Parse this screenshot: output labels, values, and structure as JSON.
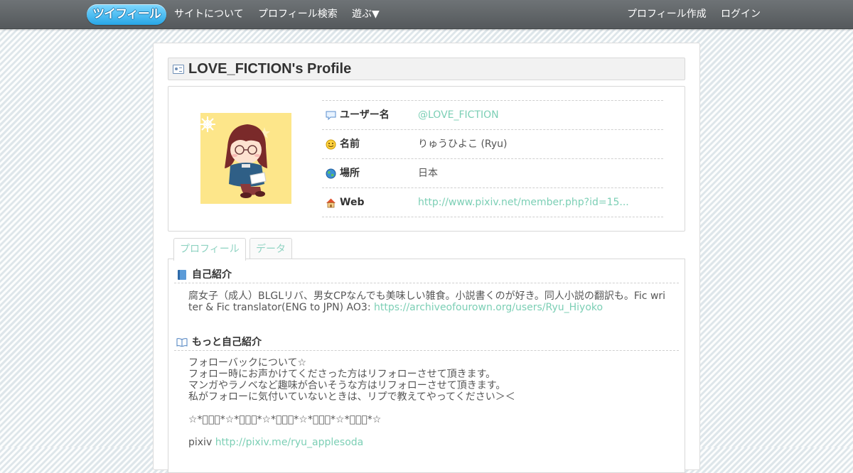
{
  "nav": {
    "logo": "ツイフィール",
    "left": [
      "サイトについて",
      "プロフィール検索",
      "遊ぶ▼"
    ],
    "right": [
      "プロフィール作成",
      "ログイン"
    ]
  },
  "profile": {
    "title": "LOVE_FICTION's Profile",
    "rows": [
      {
        "label": "ユーザー名",
        "value": "@LOVE_FICTION",
        "icon": "speech-bubble-icon"
      },
      {
        "label": "名前",
        "value": "りゅうひよこ (Ryu)",
        "icon": "smiley-icon"
      },
      {
        "label": "場所",
        "value": "日本",
        "icon": "globe-icon"
      },
      {
        "label": "Web",
        "value": "http://www.pixiv.net/member.php?id=15...",
        "icon": "house-icon"
      }
    ]
  },
  "tabs": [
    "プロフィール",
    "データ"
  ],
  "bio": {
    "heading": "自己紹介",
    "text_line1": "腐女子（成人）BLGLリバ、男女CPなんでも美味しい雑食。小説書くのが好き。同人小説の翻訳も。Fic wri",
    "text_line2": "ter & Fic translator(ENG to JPN) AO3: ",
    "ao3_link": "https://archiveofourown.org/users/Ryu_Hiyoko"
  },
  "more": {
    "heading": "もっと自己紹介",
    "lines": [
      "フォローバックについて☆",
      "フォロー時にお声かけてくださった方はリフォローさせて頂きます。",
      "マンガやラノベなど趣味が合いそうな方はリフォローさせて頂きます。",
      "私がフォローに気付いていないときは、リプで教えてやってください＞＜",
      "",
      "☆*ﾟ゜ﾟ*☆*ﾟ゜ﾟ*☆*ﾟ゜ﾟ*☆*ﾟ゜ﾟ*☆*ﾟ゜ﾟ*☆"
    ],
    "pixiv_label": "pixiv ",
    "pixiv_link": "http://pixiv.me/ryu_applesoda"
  }
}
